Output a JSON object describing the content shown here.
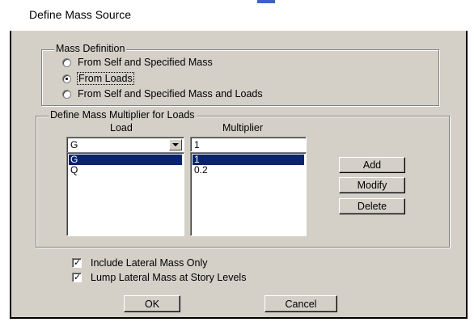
{
  "window": {
    "title": "Define Mass Source"
  },
  "mass_definition": {
    "legend": "Mass Definition",
    "options": [
      {
        "label": "From Self and Specified Mass",
        "selected": false
      },
      {
        "label": "From Loads",
        "selected": true
      },
      {
        "label": "From Self and Specified Mass and Loads",
        "selected": false
      }
    ]
  },
  "multiplier": {
    "legend": "Define Mass Multiplier for Loads",
    "load_header": "Load",
    "multiplier_header": "Multiplier",
    "load_value": "G",
    "multiplier_value": "1",
    "load_list": [
      "G",
      "Q"
    ],
    "multiplier_list": [
      "1",
      "0.2"
    ],
    "selected_index": 0,
    "add_label": "Add",
    "modify_label": "Modify",
    "delete_label": "Delete"
  },
  "options": {
    "include_lateral": {
      "label": "Include Lateral Mass Only",
      "checked": true
    },
    "lump_lateral": {
      "label": "Lump Lateral Mass at Story Levels",
      "checked": true
    }
  },
  "buttons": {
    "ok_label": "OK",
    "cancel_label": "Cancel"
  },
  "colors": {
    "face": "#d4d0c8",
    "selection": "#0a246a",
    "accent": "#3b63c6"
  },
  "icons": {
    "dropdown": "chevron-down-icon",
    "check": "check-icon"
  }
}
